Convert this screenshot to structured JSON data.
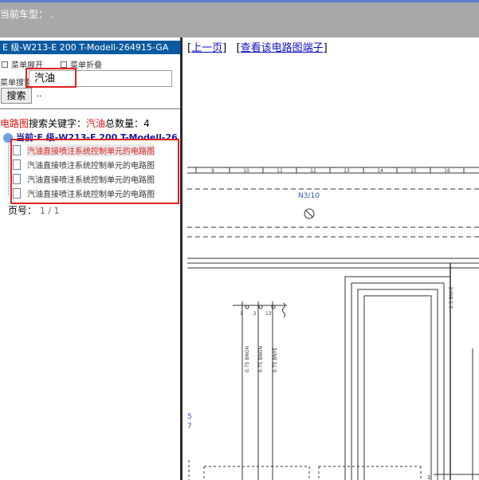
{
  "header": {
    "car_model_label": "当前车型：",
    "car_model_value": "."
  },
  "left": {
    "title": "E 级-W213-E 200 T-Modell-264915-GA",
    "menu": {
      "expand_label": "菜单展开",
      "collapse_label": "菜单折叠"
    },
    "search": {
      "label": "菜单搜索",
      "value": "汽油",
      "button_label": "搜索",
      "extra": ".."
    },
    "results": {
      "category": "电路图",
      "keyword_label": "搜索关键字：",
      "keyword": "汽油",
      "count_label": "总数量：",
      "count": "4",
      "root_label": "当前:E 级-W213-E 200 T-Modell-26",
      "items": [
        "汽油直接喷注系统控制单元的电路图",
        "汽油直接喷注系统控制单元的电路图",
        "汽油直接喷注系统控制单元的电路图",
        "汽油直接喷注系统控制单元的电路图"
      ]
    },
    "pagination": {
      "label": "页号：",
      "value": "1 / 1"
    }
  },
  "right": {
    "nav": {
      "prev": "上一页",
      "terminals": "查看该电路图端子"
    },
    "diagram": {
      "ruler": [
        "9",
        "10",
        "11",
        "12",
        "13",
        "14",
        "15",
        "16"
      ],
      "component": "N3/10",
      "pins": [
        "1",
        "2",
        "13"
      ],
      "wires": [
        "0.75 BNGN",
        "0.75 BNGN",
        "0.75 BNYE",
        "2.5 BNYE"
      ],
      "side_marks": [
        "5",
        "7"
      ],
      "bottom_pin": "1"
    }
  }
}
